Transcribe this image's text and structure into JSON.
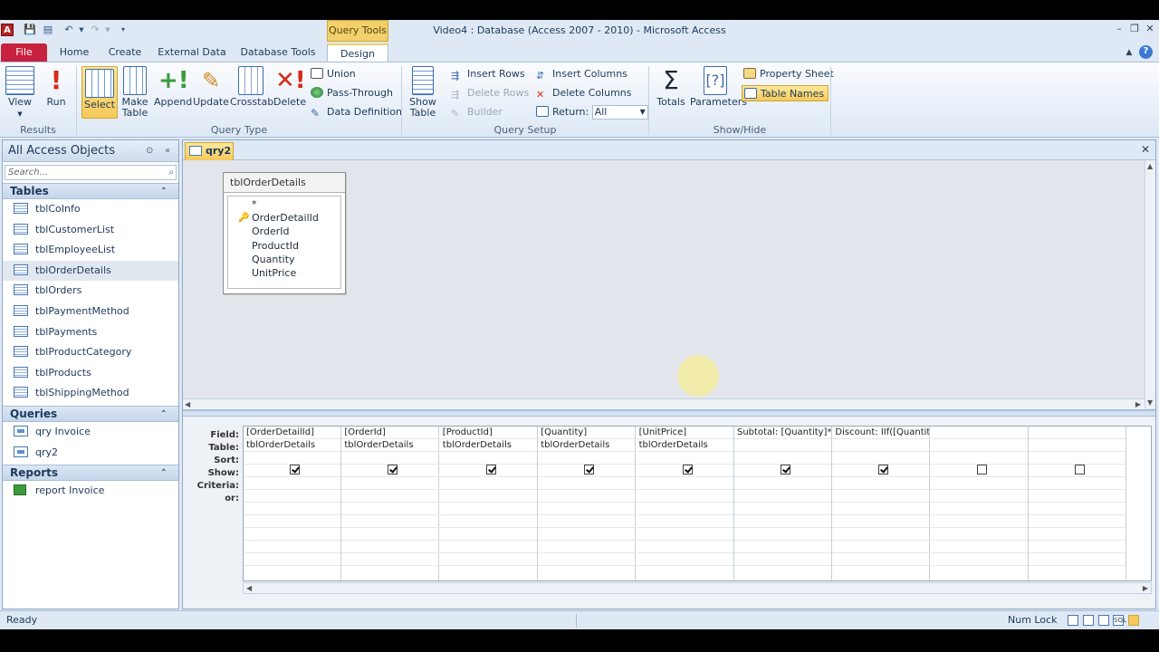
{
  "window": {
    "title": "Video4 : Database (Access 2007 - 2010) - Microsoft Access",
    "context_tab": "Query Tools",
    "app_icon": "A"
  },
  "tabs": {
    "file": "File",
    "home": "Home",
    "create": "Create",
    "external": "External Data",
    "dbtools": "Database Tools",
    "design": "Design"
  },
  "ribbon": {
    "results": {
      "label": "Results",
      "view": "View",
      "run": "Run"
    },
    "query_type": {
      "label": "Query Type",
      "select": "Select",
      "make_table_1": "Make",
      "make_table_2": "Table",
      "append": "Append",
      "update": "Update",
      "crosstab": "Crosstab",
      "delete": "Delete",
      "union": "Union",
      "pass_through": "Pass-Through",
      "data_definition": "Data Definition"
    },
    "query_setup": {
      "label": "Query Setup",
      "show_table_1": "Show",
      "show_table_2": "Table",
      "insert_rows": "Insert Rows",
      "delete_rows": "Delete Rows",
      "builder": "Builder",
      "insert_columns": "Insert Columns",
      "delete_columns": "Delete Columns",
      "return_label": "Return:",
      "return_value": "All"
    },
    "show_hide": {
      "label": "Show/Hide",
      "totals": "Totals",
      "parameters": "Parameters",
      "property_sheet": "Property Sheet",
      "table_names": "Table Names"
    }
  },
  "nav": {
    "title": "All Access Objects",
    "search_placeholder": "Search...",
    "tables_header": "Tables",
    "tables": [
      "tblCoInfo",
      "tblCustomerList",
      "tblEmployeeList",
      "tblOrderDetails",
      "tblOrders",
      "tblPaymentMethod",
      "tblPayments",
      "tblProductCategory",
      "tblProducts",
      "tblShippingMethod"
    ],
    "queries_header": "Queries",
    "queries": [
      "qry Invoice",
      "qry2"
    ],
    "reports_header": "Reports",
    "reports": [
      "report Invoice"
    ]
  },
  "document": {
    "tab": "qry2",
    "field_list": {
      "title": "tblOrderDetails",
      "fields": [
        "*",
        "OrderDetailId",
        "OrderId",
        "ProductId",
        "Quantity",
        "UnitPrice"
      ]
    },
    "row_labels": {
      "field": "Field:",
      "table": "Table:",
      "sort": "Sort:",
      "show": "Show:",
      "criteria": "Criteria:",
      "or": "or:"
    },
    "columns": [
      {
        "field": "[OrderDetailId]",
        "table": "tblOrderDetails",
        "show": true
      },
      {
        "field": "[OrderId]",
        "table": "tblOrderDetails",
        "show": true
      },
      {
        "field": "[ProductId]",
        "table": "tblOrderDetails",
        "show": true
      },
      {
        "field": "[Quantity]",
        "table": "tblOrderDetails",
        "show": true
      },
      {
        "field": "[UnitPrice]",
        "table": "tblOrderDetails",
        "show": true
      },
      {
        "field": "Subtotal: [Quantity]*[",
        "table": "",
        "show": true
      },
      {
        "field": "Discount: IIf([Quantity",
        "table": "",
        "show": true
      },
      {
        "field": "",
        "table": "",
        "show": false
      },
      {
        "field": "",
        "table": "",
        "show": false
      }
    ]
  },
  "status": {
    "ready": "Ready",
    "num_lock": "Num Lock"
  }
}
